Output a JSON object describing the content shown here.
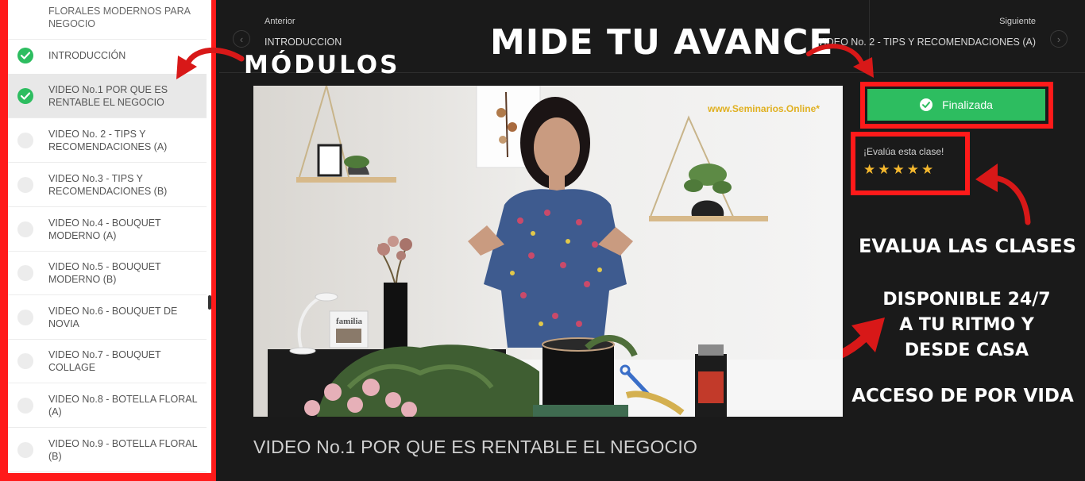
{
  "sidebar": {
    "items": [
      {
        "label": "FLORALES MODERNOS PARA NEGOCIO",
        "done": false,
        "active": false
      },
      {
        "label": "INTRODUCCIÓN",
        "done": true,
        "active": false
      },
      {
        "label": "VIDEO No.1 POR QUE ES RENTABLE EL NEGOCIO",
        "done": true,
        "active": true
      },
      {
        "label": "VIDEO No. 2 - TIPS Y RECOMENDACIONES (A)",
        "done": false,
        "active": false
      },
      {
        "label": "VIDEO No.3 - TIPS Y RECOMENDACIONES (B)",
        "done": false,
        "active": false
      },
      {
        "label": "VIDEO No.4 - BOUQUET MODERNO (A)",
        "done": false,
        "active": false
      },
      {
        "label": "VIDEO No.5 - BOUQUET MODERNO (B)",
        "done": false,
        "active": false
      },
      {
        "label": "VIDEO No.6 - BOUQUET DE NOVIA",
        "done": false,
        "active": false
      },
      {
        "label": "VIDEO No.7 - BOUQUET COLLAGE",
        "done": false,
        "active": false
      },
      {
        "label": "VIDEO No.8 - BOTELLA FLORAL (A)",
        "done": false,
        "active": false
      },
      {
        "label": "VIDEO No.9 - BOTELLA FLORAL (B)",
        "done": false,
        "active": false
      }
    ]
  },
  "nav": {
    "prev_small": "Anterior",
    "prev_title": "INTRODUCCION",
    "next_small": "Siguiente",
    "next_title": "VIDEO No. 2 - TIPS Y RECOMENDACIONES (A)"
  },
  "overlay": {
    "modulos": "MÓDULOS",
    "mide": "MIDE TU AVANCE",
    "evalua": "EVALUA LAS CLASES",
    "disponible_1": "DISPONIBLE 24/7",
    "disponible_2": "A TU RITMO Y",
    "disponible_3": "DESDE CASA",
    "acceso": "ACCESO DE POR VIDA"
  },
  "video": {
    "watermark": "www.Seminarios.Online*",
    "frame_text": "familia",
    "title": "VIDEO No.1 POR QUE ES RENTABLE EL NEGOCIO"
  },
  "panel": {
    "finish_label": "Finalizada",
    "rate_label": "¡Evalúa esta clase!",
    "stars": 5
  },
  "colors": {
    "accent_red": "#ff1a1a",
    "success_green": "#2dbd60",
    "star_gold": "#f5b82e",
    "background": "#1a1a1a"
  },
  "icons": [
    "chevron-left-icon",
    "chevron-right-icon",
    "check-circle-icon",
    "star-icon",
    "curved-arrow-icon"
  ]
}
